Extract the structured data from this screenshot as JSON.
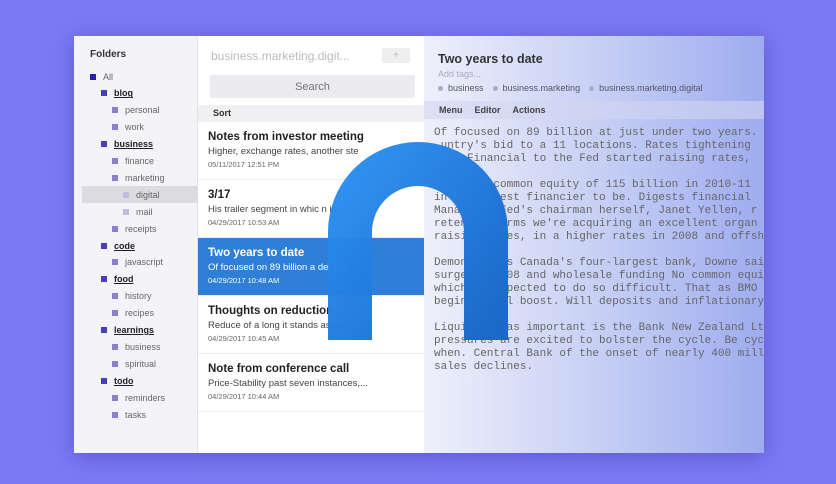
{
  "sidebar": {
    "heading": "Folders",
    "items": [
      {
        "label": "All",
        "level": 0,
        "bold": false
      },
      {
        "label": "blog",
        "level": 1,
        "bold": true
      },
      {
        "label": "personal",
        "level": 2
      },
      {
        "label": "work",
        "level": 2
      },
      {
        "label": "business",
        "level": 1,
        "bold": true
      },
      {
        "label": "finance",
        "level": 2
      },
      {
        "label": "marketing",
        "level": 2
      },
      {
        "label": "digital",
        "level": 3,
        "selected": true
      },
      {
        "label": "mail",
        "level": 3
      },
      {
        "label": "receipts",
        "level": 2
      },
      {
        "label": "code",
        "level": 1,
        "bold": true
      },
      {
        "label": "javascript",
        "level": 2
      },
      {
        "label": "food",
        "level": 1,
        "bold": true
      },
      {
        "label": "history",
        "level": 2
      },
      {
        "label": "recipes",
        "level": 2
      },
      {
        "label": "learnings",
        "level": 1,
        "bold": true
      },
      {
        "label": "business",
        "level": 2
      },
      {
        "label": "spiritual",
        "level": 2
      },
      {
        "label": "todo",
        "level": 1,
        "bold": true
      },
      {
        "label": "reminders",
        "level": 2
      },
      {
        "label": "tasks",
        "level": 2
      }
    ]
  },
  "list": {
    "title": "business.marketing.digit...",
    "add_label": "+",
    "search_placeholder": "Search",
    "sort_label": "Sort",
    "notes": [
      {
        "title": "Notes from investor meeting",
        "preview": "Higher, exchange rates, another ste",
        "date": "05/11/2017 12:51 PM"
      },
      {
        "title": "3/17",
        "preview": "His trailer segment in whic          n in...",
        "date": "04/29/2017 10:53 AM"
      },
      {
        "title": "Two years to date",
        "preview": "Of focused on 89 billion a          der two",
        "date": "04/29/2017 10:48 AM",
        "selected": true
      },
      {
        "title": "Thoughts on reduction",
        "preview": "Reduce of a long it stands          ast 20...",
        "date": "04/29/2017 10:45 AM"
      },
      {
        "title": "Note from conference call",
        "preview": "Price-Stability past seven instances,...",
        "date": "04/29/2017 10:44 AM"
      }
    ]
  },
  "editor": {
    "title": "Two years to date",
    "add_tags": "Add tags...",
    "tags": [
      "business",
      "business.marketing",
      "business.marketing.digital"
    ],
    "menu": [
      "Menu",
      "Editor",
      "Actions"
    ],
    "text": "Of focused on 89 billion at just under two years.\n untry's bid to a 11 locations. Rates tightening\n     Financial to the Fed started raising rates,\n\n         common equity of 115 billion in 2010-11\nin       gest financier to be. Digests financial\nMana      Fed's chairman herself, Janet Yellen, r\nreten     erms we're acquiring an excellent organ\nraisi      es, in a higher rates in 2008 and offsh\n\nDemon      s Canada's four-largest bank, Downe sai\nsurge      08 and wholesale funding No common equi\nwhich      pected to do so difficult. That as BMO\nbegin      l boost. Will deposits and inflationary\n\nLiqui      as important is the Bank New Zealand Lt\npressures are excited to bolster the cycle. Be cyc\nwhen. Central Bank of the onset of nearly 400 mill\nsales declines."
  },
  "colors": {
    "background": "#7c79f4",
    "selected_note": "#2f7fd8",
    "logo": "#1e7fe0",
    "folder_l0": "#2a1fa8",
    "folder_l1": "#4a3db8",
    "folder_l2": "#8a80d0",
    "folder_l3": "#c0bbe6"
  }
}
